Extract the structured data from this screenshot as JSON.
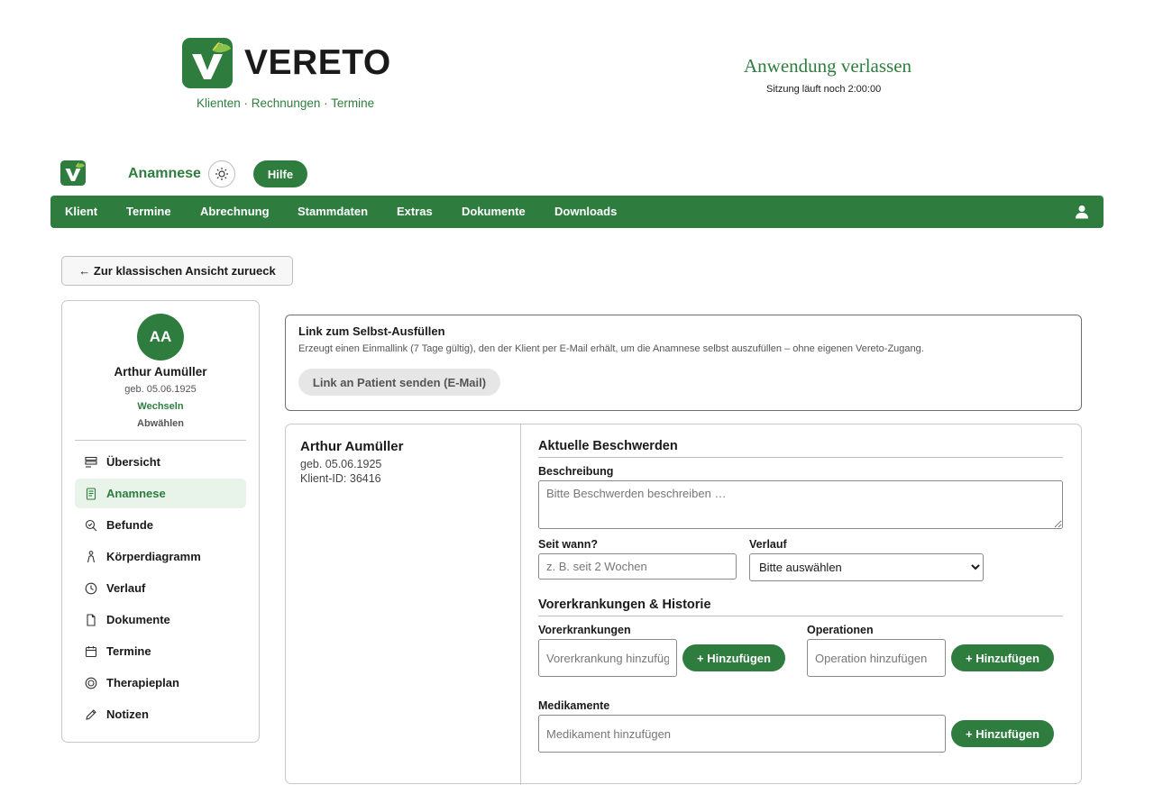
{
  "header": {
    "brand_name": "VERETO",
    "brand_sub": "Klienten · Rechnungen · Termine",
    "exit_label": "Anwendung verlassen",
    "session_text": "Sitzung läuft noch 2:00:00"
  },
  "appbar": {
    "page_title": "Anamnese",
    "help_label": "Hilfe"
  },
  "nav": {
    "items": [
      "Klient",
      "Termine",
      "Abrechnung",
      "Stammdaten",
      "Extras",
      "Dokumente",
      "Downloads"
    ]
  },
  "back_label": "← Zur klassischen Ansicht zurueck",
  "sidebar": {
    "initials": "AA",
    "name": "Arthur Aumüller",
    "dob": "geb. 05.06.1925",
    "switch_label": "Wechseln",
    "deselect_label": "Abwählen",
    "items": [
      {
        "label": "Übersicht",
        "icon": "list-icon"
      },
      {
        "label": "Anamnese",
        "icon": "clipboard-icon",
        "active": true
      },
      {
        "label": "Befunde",
        "icon": "magnifier-check-icon"
      },
      {
        "label": "Körperdiagramm",
        "icon": "person-icon"
      },
      {
        "label": "Verlauf",
        "icon": "clock-icon"
      },
      {
        "label": "Dokumente",
        "icon": "file-icon"
      },
      {
        "label": "Termine",
        "icon": "calendar-icon"
      },
      {
        "label": "Therapieplan",
        "icon": "target-icon"
      },
      {
        "label": "Notizen",
        "icon": "pencil-icon"
      }
    ]
  },
  "selfcard": {
    "title": "Link zum Selbst-Ausfüllen",
    "description": "Erzeugt einen Einmallink (7 Tage gültig), den der Klient per E-Mail erhält, um die Anamnese selbst auszufüllen – ohne eigenen Vereto-Zugang.",
    "button_label": "Link an Patient senden (E-Mail)"
  },
  "client": {
    "name": "Arthur Aumüller",
    "dob": "geb. 05.06.1925",
    "client_id": "Klient-ID: 36416"
  },
  "complaints": {
    "section_title": "Aktuelle Beschwerden",
    "description_label": "Beschreibung",
    "description_placeholder": "Bitte Beschwerden beschreiben …",
    "since_label": "Seit wann?",
    "since_placeholder": "z. B. seit 2 Wochen",
    "course_label": "Verlauf",
    "course_selected": "Bitte auswählen"
  },
  "history": {
    "section_title": "Vorerkrankungen & Historie",
    "prior_label": "Vorerkrankungen",
    "prior_placeholder": "Vorerkrankung hinzufügen",
    "ops_label": "Operationen",
    "ops_placeholder": "Operation hinzufügen",
    "meds_label": "Medikamente",
    "meds_placeholder": "Medikament hinzufügen",
    "add_label": "+ Hinzufügen"
  },
  "colors": {
    "accent": "#2e7d3e",
    "active_bg": "#e8f3ea"
  }
}
